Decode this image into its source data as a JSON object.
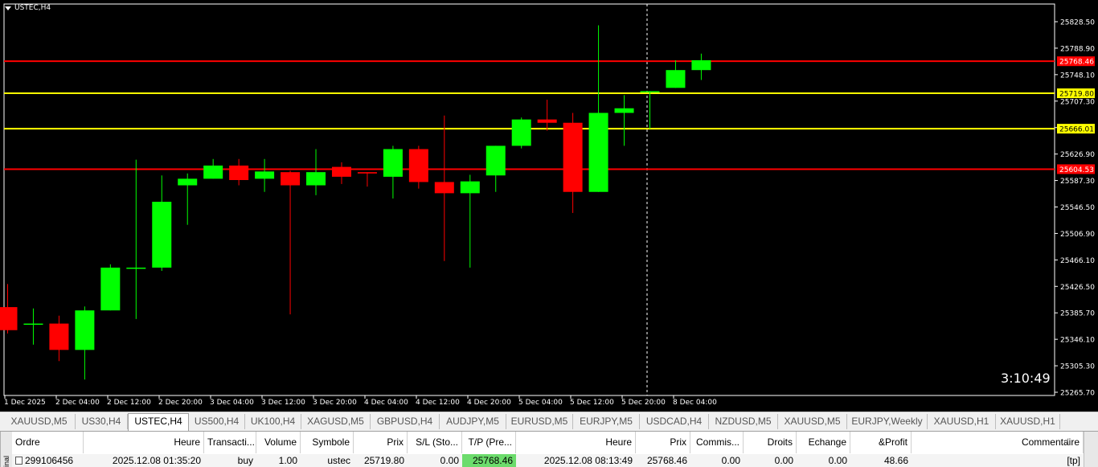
{
  "chart": {
    "symbol": "USTEC,H4",
    "countdown": "3:10:49",
    "price_min": 25250,
    "price_max": 25845,
    "price_ticks": [
      "25828.50",
      "25788.90",
      "25748.10",
      "25707.30",
      "25666.50",
      "25626.90",
      "25587.30",
      "25546.50",
      "25506.90",
      "25466.10",
      "25426.50",
      "25385.70",
      "25346.10",
      "25305.30",
      "25265.70"
    ],
    "hlines": [
      {
        "price": 25768.46,
        "color": "#ff0000",
        "label": "25768.46",
        "label_bg": "#ff0000",
        "label_color": "#ffffff"
      },
      {
        "price": 25719.8,
        "color": "#ffff00",
        "label": "25719.80",
        "label_bg": "#ffff00",
        "label_color": "#000000"
      },
      {
        "price": 25666.01,
        "color": "#ffff00",
        "label": "25666.01",
        "label_bg": "#ffff00",
        "label_color": "#000000"
      },
      {
        "price": 25604.53,
        "color": "#ff0000",
        "label": "25604.53",
        "label_bg": "#ff0000",
        "label_color": "#ffffff"
      }
    ],
    "time_labels": [
      "1 Dec 2025",
      "2 Dec 04:00",
      "2 Dec 12:00",
      "2 Dec 20:00",
      "3 Dec 04:00",
      "3 Dec 12:00",
      "3 Dec 20:00",
      "4 Dec 04:00",
      "4 Dec 12:00",
      "4 Dec 20:00",
      "5 Dec 04:00",
      "5 Dec 12:00",
      "5 Dec 20:00",
      "8 Dec 04:00"
    ],
    "up_color": "#00ff00",
    "down_color": "#ff0000",
    "candles": [
      {
        "o": 25395,
        "h": 25430,
        "l": 25355,
        "c": 25360
      },
      {
        "o": 25370,
        "h": 25393,
        "l": 25338,
        "c": 25370
      },
      {
        "o": 25370,
        "h": 25382,
        "l": 25313,
        "c": 25330
      },
      {
        "o": 25330,
        "h": 25396,
        "l": 25285,
        "c": 25390
      },
      {
        "o": 25390,
        "h": 25460,
        "l": 25390,
        "c": 25455
      },
      {
        "o": 25455,
        "h": 25619,
        "l": 25377,
        "c": 25455
      },
      {
        "o": 25455,
        "h": 25595,
        "l": 25450,
        "c": 25555
      },
      {
        "o": 25580,
        "h": 25598,
        "l": 25520,
        "c": 25590
      },
      {
        "o": 25590,
        "h": 25620,
        "l": 25590,
        "c": 25610
      },
      {
        "o": 25610,
        "h": 25620,
        "l": 25580,
        "c": 25588
      },
      {
        "o": 25590,
        "h": 25620,
        "l": 25570,
        "c": 25601
      },
      {
        "o": 25600,
        "h": 25602,
        "l": 25384,
        "c": 25580
      },
      {
        "o": 25580,
        "h": 25635,
        "l": 25565,
        "c": 25600
      },
      {
        "o": 25608,
        "h": 25615,
        "l": 25582,
        "c": 25593
      },
      {
        "o": 25600,
        "h": 25600,
        "l": 25578,
        "c": 25598
      },
      {
        "o": 25593,
        "h": 25640,
        "l": 25560,
        "c": 25635
      },
      {
        "o": 25635,
        "h": 25640,
        "l": 25575,
        "c": 25585
      },
      {
        "o": 25585,
        "h": 25686,
        "l": 25465,
        "c": 25568
      },
      {
        "o": 25568,
        "h": 25596,
        "l": 25455,
        "c": 25586
      },
      {
        "o": 25595,
        "h": 25640,
        "l": 25570,
        "c": 25640
      },
      {
        "o": 25640,
        "h": 25683,
        "l": 25636,
        "c": 25680
      },
      {
        "o": 25680,
        "h": 25710,
        "l": 25663,
        "c": 25675
      },
      {
        "o": 25675,
        "h": 25690,
        "l": 25538,
        "c": 25570
      },
      {
        "o": 25570,
        "h": 25823,
        "l": 25570,
        "c": 25690
      },
      {
        "o": 25690,
        "h": 25717,
        "l": 25640,
        "c": 25697
      },
      {
        "o": 25723,
        "h": 25723,
        "l": 25666,
        "c": 25723
      },
      {
        "o": 25728,
        "h": 25770,
        "l": 25728,
        "c": 25755
      },
      {
        "o": 25755,
        "h": 25780,
        "l": 25740,
        "c": 25770
      }
    ]
  },
  "tabs": [
    "XAUUSD,M5",
    "US30,H4",
    "USTEC,H4",
    "US500,H4",
    "UK100,H4",
    "XAGUSD,M5",
    "GBPUSD,H4",
    "AUDJPY,M5",
    "EURUSD,M5",
    "EURJPY,M5",
    "USDCAD,H4",
    "NZDUSD,M5",
    "XAUUSD,M5",
    "EURJPY,Weekly",
    "XAUUSD,H1",
    "XAUUSD,H1"
  ],
  "active_tab": "USTEC,H4",
  "terminal": {
    "side_label": "inal",
    "columns": [
      "Ordre",
      "Heure",
      "Transacti...",
      "Volume",
      "Symbole",
      "Prix",
      "S/L (Sto...",
      "T/P (Pre...",
      "Heure",
      "Prix",
      "Commis...",
      "Droits",
      "Echange",
      "&Profit",
      "Commentaire"
    ],
    "sort_indicator": "/",
    "row": [
      "299106456",
      "2025.12.08 01:35:20",
      "buy",
      "1.00",
      "ustec",
      "25719.80",
      "0.00",
      "25768.46",
      "2025.12.08 08:13:49",
      "25768.46",
      "0.00",
      "0.00",
      "0.00",
      "48.66",
      "[tp]"
    ]
  }
}
